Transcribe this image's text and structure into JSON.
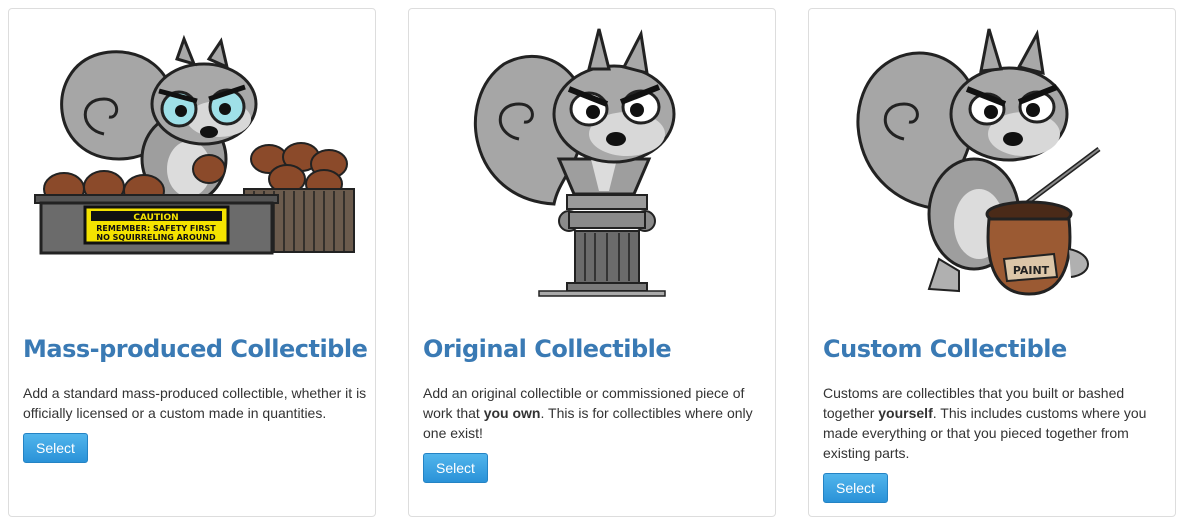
{
  "colors": {
    "title": "#3a7ab4",
    "button": "#3a9fe4",
    "border": "#dddddd"
  },
  "cards": [
    {
      "title": "Mass-produced Collectible",
      "description": "Add a standard mass-produced collectible, whether it is officially licensed or a custom made in quantities.",
      "button": "Select",
      "illustration": "squirrel-with-acorns-icon",
      "sign": {
        "line1": "CAUTION",
        "line2": "REMEMBER: SAFETY FIRST",
        "line3": "NO SQUIRRELING AROUND"
      }
    },
    {
      "title": "Original Collectible",
      "desc_pre": "Add an original collectible or commissioned piece of work that ",
      "desc_bold": "you own",
      "desc_post": ". This is for collectibles where only one exist!",
      "button": "Select",
      "illustration": "squirrel-bust-on-pedestal-icon"
    },
    {
      "title": "Custom Collectible",
      "desc_pre": "Customs are collectibles that you built or bashed together ",
      "desc_bold": "yourself",
      "desc_post": ". This includes customs where you made everything or that you pieced together from existing parts.",
      "button": "Select",
      "illustration": "squirrel-with-paint-pot-icon",
      "pot_label": "PAINT"
    }
  ]
}
